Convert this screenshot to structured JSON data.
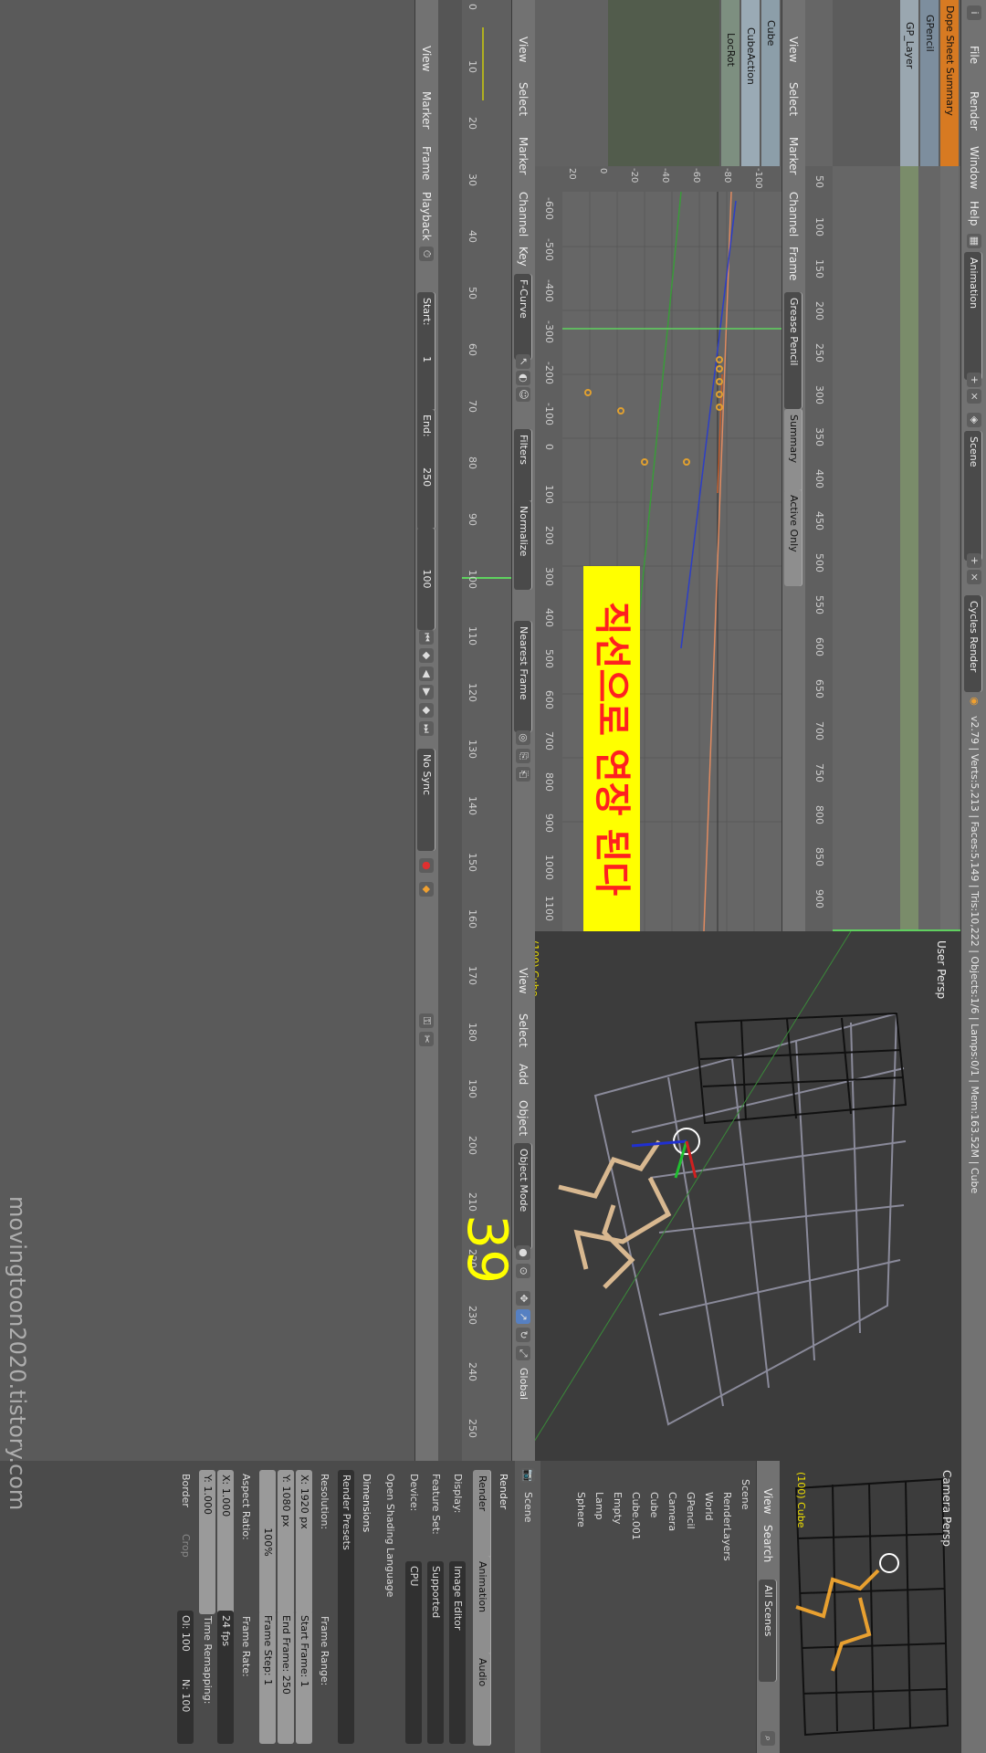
{
  "info_bar": {
    "menus": [
      "File",
      "Render",
      "Window",
      "Help"
    ],
    "layout": "Animation",
    "scene": "Scene",
    "engine": "Cycles Render",
    "stats": "v2.79 | Verts:5,213 | Faces:5,149 | Tris:10,222 | Objects:1/6 | Lamps:0/1 | Mem:163.52M | Cube"
  },
  "dopesheet": {
    "channels": [
      "Dope Sheet Summary",
      "GPencil",
      "GP_Layer"
    ],
    "frame_ticks": [
      "50",
      "100",
      "150",
      "200",
      "250",
      "300",
      "350",
      "400",
      "450",
      "500",
      "550",
      "600",
      "650",
      "700",
      "750",
      "800",
      "850",
      "900"
    ],
    "current_frame": "100",
    "header": [
      "View",
      "Select",
      "Marker",
      "Channel",
      "Frame"
    ],
    "mode": "Grease Pencil",
    "summary_label": "Summary",
    "active_only": "Active Only"
  },
  "graph_editor": {
    "channels": [
      "Cube",
      "CubeAction",
      "LocRot"
    ],
    "value_ticks": [
      "-100",
      "-80",
      "-60",
      "-40",
      "-20",
      "0",
      "20"
    ],
    "frame_ticks": [
      "-600",
      "-500",
      "-400",
      "-300",
      "-200",
      "-100",
      "0",
      "100",
      "200",
      "300",
      "400",
      "500",
      "600",
      "700",
      "800",
      "900",
      "1000",
      "1100"
    ],
    "current_frame": "100",
    "header": [
      "View",
      "Select",
      "Marker",
      "Channel",
      "Key"
    ],
    "mode": "F-Curve",
    "filters": "Filters",
    "normalize": "Normalize",
    "pivot": "Nearest Frame",
    "annotation": "직선으로 연장 된다",
    "annotation_color": "#ff2020",
    "annotation_bg": "#ffff00"
  },
  "viewport": {
    "title": "User Persp",
    "object_label": "(100) Cube",
    "header": [
      "View",
      "Select",
      "Add",
      "Object"
    ],
    "mode": "Object Mode",
    "orientation": "Global"
  },
  "timeline": {
    "ticks": [
      "0",
      "10",
      "20",
      "30",
      "40",
      "50",
      "60",
      "70",
      "80",
      "90",
      "100",
      "110",
      "120",
      "130",
      "140",
      "150",
      "160",
      "170",
      "180",
      "190",
      "200",
      "210",
      "220",
      "230",
      "240",
      "250"
    ],
    "menus": [
      "View",
      "Marker",
      "Frame",
      "Playback"
    ],
    "start_label": "Start:",
    "start_value": "1",
    "end_label": "End:",
    "end_value": "250",
    "current": "100",
    "sync": "No Sync",
    "overlay_frame": "39"
  },
  "camera_view": {
    "title": "Camera Persp",
    "object_label": "(100) Cube"
  },
  "outliner": {
    "header": [
      "View",
      "Search",
      "All Scenes"
    ],
    "items": [
      "Scene",
      "RenderLayers",
      "World",
      "GPencil",
      "Camera",
      "Cube",
      "Cube.001",
      "Empty",
      "Lamp",
      "Sphere"
    ]
  },
  "properties": {
    "tab_scene": "Scene",
    "section_render": "Render",
    "render_buttons": [
      "Render",
      "Animation",
      "Audio"
    ],
    "display_label": "Display:",
    "display_value": "Image Editor",
    "feature_set_label": "Feature Set:",
    "feature_set_value": "Supported",
    "device_label": "Device:",
    "device_value": "CPU",
    "osl_label": "Open Shading Language",
    "dimensions_label": "Dimensions",
    "render_presets": "Render Presets",
    "resolution_label": "Resolution:",
    "res_x": "X:  1920 px",
    "res_y": "Y:  1080 px",
    "res_pct": "100%",
    "frame_range_label": "Frame Range:",
    "start_frame": "Start Frame:  1",
    "end_frame": "End Frame:  250",
    "frame_step": "Frame Step:  1",
    "aspect_label": "Aspect Ratio:",
    "aspect_x": "X:  1.000",
    "aspect_y": "Y:  1.000",
    "frame_rate_label": "Frame Rate:",
    "frame_rate": "24 fps",
    "border_label": "Border",
    "crop_label": "Crop",
    "time_remap_label": "Time Remapping:",
    "time_old": "Ol: 100",
    "time_new": "N: 100"
  },
  "watermark": "movingtoon2020.tistory.com"
}
